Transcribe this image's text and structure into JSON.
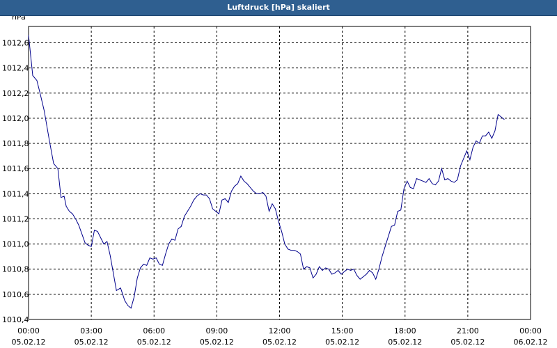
{
  "window": {
    "title": "Luftdruck [hPa] skaliert"
  },
  "chart_data": {
    "type": "line",
    "title": "Luftdruck [hPa] skaliert",
    "ylabel": "hPa",
    "xlabel": "",
    "grid": true,
    "ylim": [
      1010.4,
      1012.73
    ],
    "xlim_hours": [
      0,
      24
    ],
    "y_ticks": [
      "1010,4",
      "1010,6",
      "1010,8",
      "1011,0",
      "1011,2",
      "1011,4",
      "1011,6",
      "1011,8",
      "1012,0",
      "1012,2",
      "1012,4",
      "1012,6"
    ],
    "x_ticks": [
      {
        "time": "00:00",
        "date": "05.02.12"
      },
      {
        "time": "03:00",
        "date": "05.02.12"
      },
      {
        "time": "06:00",
        "date": "05.02.12"
      },
      {
        "time": "09:00",
        "date": "05.02.12"
      },
      {
        "time": "12:00",
        "date": "05.02.12"
      },
      {
        "time": "15:00",
        "date": "05.02.12"
      },
      {
        "time": "18:00",
        "date": "05.02.12"
      },
      {
        "time": "21:00",
        "date": "05.02.12"
      },
      {
        "time": "00:00",
        "date": "06.02.12"
      }
    ],
    "series": [
      {
        "color": "#00008b",
        "x_hours": [
          0.0,
          0.2,
          0.4,
          0.55,
          0.75,
          1.0,
          1.2,
          1.4,
          1.55,
          1.7,
          1.8,
          1.95,
          2.1,
          2.25,
          2.4,
          2.55,
          2.7,
          2.85,
          3.0,
          3.15,
          3.3,
          3.45,
          3.6,
          3.75,
          3.9,
          4.05,
          4.2,
          4.4,
          4.6,
          4.75,
          4.9,
          5.05,
          5.2,
          5.35,
          5.5,
          5.65,
          5.8,
          5.95,
          6.1,
          6.25,
          6.4,
          6.55,
          6.7,
          6.85,
          7.0,
          7.15,
          7.3,
          7.45,
          7.6,
          7.75,
          7.9,
          8.05,
          8.2,
          8.35,
          8.5,
          8.65,
          8.8,
          8.95,
          9.1,
          9.25,
          9.4,
          9.55,
          9.7,
          9.85,
          10.0,
          10.15,
          10.3,
          10.45,
          10.6,
          10.75,
          10.9,
          11.05,
          11.2,
          11.35,
          11.5,
          11.65,
          11.8,
          11.95,
          12.1,
          12.25,
          12.4,
          12.55,
          12.7,
          12.85,
          13.0,
          13.15,
          13.3,
          13.45,
          13.6,
          13.75,
          13.9,
          14.05,
          14.2,
          14.35,
          14.5,
          14.65,
          14.8,
          14.95,
          15.1,
          15.25,
          15.4,
          15.55,
          15.7,
          15.85,
          16.0,
          16.15,
          16.3,
          16.45,
          16.6,
          16.75,
          16.9,
          17.05,
          17.2,
          17.35,
          17.5,
          17.65,
          17.8,
          17.95,
          18.1,
          18.25,
          18.4,
          18.55,
          18.7,
          18.85,
          19.0,
          19.15,
          19.3,
          19.45,
          19.6,
          19.75,
          19.9,
          20.05,
          20.2,
          20.35,
          20.5,
          20.65,
          20.8,
          20.95,
          21.1,
          21.25,
          21.4,
          21.55,
          21.7,
          21.85,
          22.0,
          22.15,
          22.3,
          22.45,
          22.6,
          22.75,
          22.9,
          23.05,
          23.2,
          23.35,
          23.5,
          23.65
        ],
        "values": [
          1012.66,
          1012.34,
          1012.3,
          1012.2,
          1012.06,
          1011.82,
          1011.64,
          1011.6,
          1011.37,
          1011.38,
          1011.3,
          1011.26,
          1011.24,
          1011.2,
          1011.15,
          1011.08,
          1011.01,
          1010.99,
          1010.98,
          1011.11,
          1011.1,
          1011.05,
          1011.0,
          1011.02,
          1010.91,
          1010.77,
          1010.63,
          1010.65,
          1010.55,
          1010.51,
          1010.49,
          1010.58,
          1010.73,
          1010.81,
          1010.84,
          1010.83,
          1010.89,
          1010.88,
          1010.89,
          1010.84,
          1010.83,
          1010.92,
          1011.0,
          1011.04,
          1011.03,
          1011.12,
          1011.14,
          1011.22,
          1011.26,
          1011.3,
          1011.35,
          1011.38,
          1011.4,
          1011.39,
          1011.39,
          1011.36,
          1011.28,
          1011.26,
          1011.24,
          1011.35,
          1011.36,
          1011.33,
          1011.42,
          1011.46,
          1011.48,
          1011.54,
          1011.5,
          1011.48,
          1011.45,
          1011.42,
          1011.4,
          1011.4,
          1011.41,
          1011.38,
          1011.26,
          1011.32,
          1011.28,
          1011.18,
          1011.1,
          1011.0,
          1010.96,
          1010.95,
          1010.95,
          1010.94,
          1010.92,
          1010.8,
          1010.82,
          1010.81,
          1010.73,
          1010.76,
          1010.82,
          1010.79,
          1010.81,
          1010.8,
          1010.76,
          1010.77,
          1010.79,
          1010.76,
          1010.78,
          1010.8,
          1010.79,
          1010.8,
          1010.75,
          1010.72,
          1010.74,
          1010.76,
          1010.79,
          1010.77,
          1010.72,
          1010.8,
          1010.9,
          1010.98,
          1011.06,
          1011.14,
          1011.15,
          1011.26,
          1011.27,
          1011.44,
          1011.5,
          1011.45,
          1011.44,
          1011.52,
          1011.51,
          1011.5,
          1011.49,
          1011.52,
          1011.48,
          1011.47,
          1011.5,
          1011.6,
          1011.51,
          1011.52,
          1011.5,
          1011.49,
          1011.51,
          1011.62,
          1011.68,
          1011.74,
          1011.67,
          1011.77,
          1011.82,
          1011.8,
          1011.86,
          1011.86,
          1011.89,
          1011.84,
          1011.9,
          1012.03,
          1012.01,
          1011.99
        ]
      }
    ]
  }
}
